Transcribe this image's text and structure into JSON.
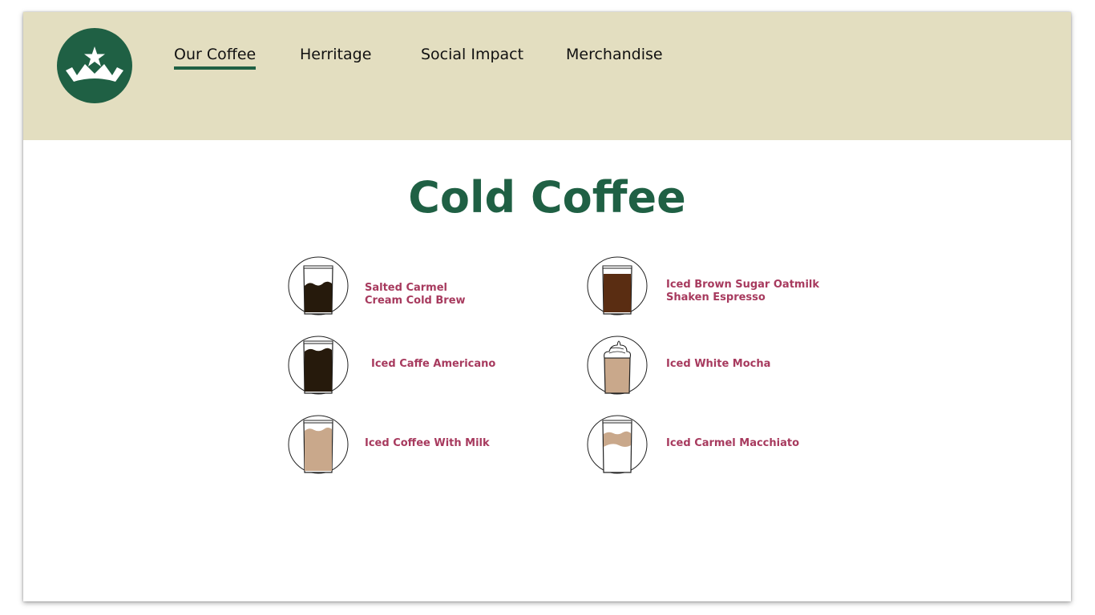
{
  "header": {
    "logo_alt": "crown-star-logo",
    "nav": [
      {
        "label": "Our Coffee",
        "active": true
      },
      {
        "label": "Herritage",
        "active": false
      },
      {
        "label": "Social Impact",
        "active": false
      },
      {
        "label": "Merchandise",
        "active": false
      }
    ]
  },
  "main": {
    "title": "Cold Coffee",
    "items": [
      {
        "label": "Salted Carmel\nCream Cold Brew",
        "drink": "dark-cream"
      },
      {
        "label": "Iced Brown Sugar Oatmilk\nShaken Espresso",
        "drink": "brown"
      },
      {
        "label": "Iced Caffe Americano",
        "drink": "dark"
      },
      {
        "label": "Iced White Mocha",
        "drink": "whipped"
      },
      {
        "label": "Iced Coffee With Milk",
        "drink": "milk"
      },
      {
        "label": "Iced Carmel Macchiato",
        "drink": "layered"
      }
    ]
  },
  "colors": {
    "header_bg": "#e3dec0",
    "brand_green": "#1f6044",
    "label_pink": "#a73a5e",
    "dark_coffee": "#261a0c",
    "brown_coffee": "#5a2d12",
    "milk_coffee": "#c9a88b"
  }
}
